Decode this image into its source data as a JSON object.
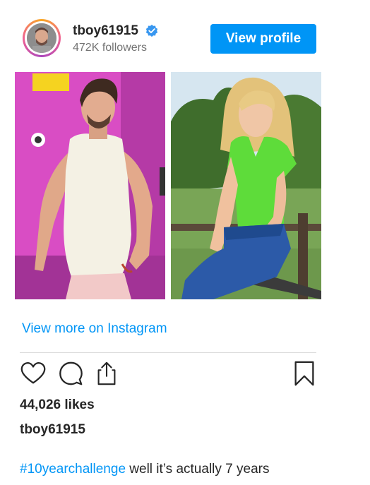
{
  "header": {
    "username": "tboy61915",
    "followers": "472K followers",
    "view_profile_label": "View profile"
  },
  "post": {
    "images": [
      "photo-left",
      "photo-right"
    ],
    "view_more_label": "View more on Instagram",
    "likes": "44,026 likes",
    "caption_user": "tboy61915",
    "caption_hashtag": "#10yearchallenge",
    "caption_text": " well it’s actually 7 years"
  },
  "icons": {
    "like": "heart-icon",
    "comment": "comment-icon",
    "share": "share-icon",
    "save": "bookmark-icon",
    "verified": "verified-badge-icon"
  },
  "colors": {
    "accent": "#0095f6",
    "text": "#262626",
    "muted": "#737373"
  }
}
